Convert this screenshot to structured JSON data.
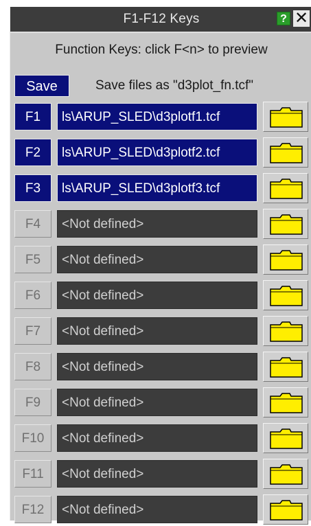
{
  "window": {
    "title": "F1-F12 Keys",
    "help_label": "?",
    "close_label": "✕"
  },
  "instruction": "Function Keys: click F<n> to preview",
  "save": {
    "label": "Save",
    "description": "Save files as \"d3plot_fn.tcf\""
  },
  "keys": [
    {
      "key": "F1",
      "value": "ls\\ARUP_SLED\\d3plotf1.tcf",
      "defined": true
    },
    {
      "key": "F2",
      "value": "ls\\ARUP_SLED\\d3plotf2.tcf",
      "defined": true
    },
    {
      "key": "F3",
      "value": "ls\\ARUP_SLED\\d3plotf3.tcf",
      "defined": true
    },
    {
      "key": "F4",
      "value": "<Not defined>",
      "defined": false
    },
    {
      "key": "F5",
      "value": "<Not defined>",
      "defined": false
    },
    {
      "key": "F6",
      "value": "<Not defined>",
      "defined": false
    },
    {
      "key": "F7",
      "value": "<Not defined>",
      "defined": false
    },
    {
      "key": "F8",
      "value": "<Not defined>",
      "defined": false
    },
    {
      "key": "F9",
      "value": "<Not defined>",
      "defined": false
    },
    {
      "key": "F10",
      "value": "<Not defined>",
      "defined": false
    },
    {
      "key": "F11",
      "value": "<Not defined>",
      "defined": false
    },
    {
      "key": "F12",
      "value": "<Not defined>",
      "defined": false
    }
  ],
  "colors": {
    "defined_bg": "#0a0f7a",
    "undefined_bg": "#3c3c3c",
    "folder_fill": "#ffee00",
    "panel_bg": "#c8c8c8",
    "help_bg": "#2a9d2a"
  },
  "icons": {
    "folder": "folder-icon",
    "help": "help-icon",
    "close": "close-icon"
  }
}
